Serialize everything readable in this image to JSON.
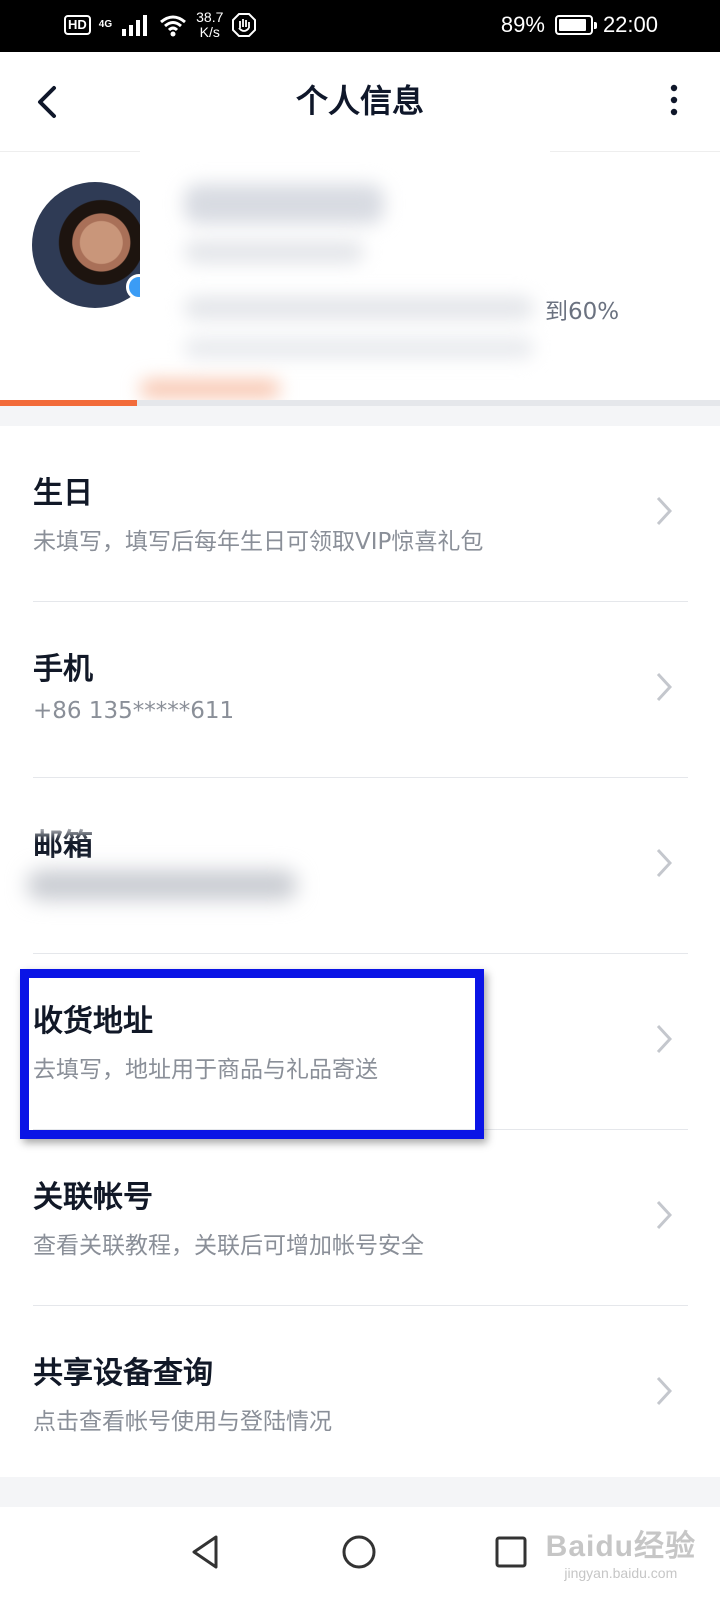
{
  "status_bar": {
    "hd": "HD",
    "network": "4G",
    "speed_value": "38.7",
    "speed_unit": "K/s",
    "battery_percent": "89%",
    "battery_level": 0.89,
    "time": "22:00"
  },
  "header": {
    "title": "个人信息",
    "back_icon": "chevron-left-icon",
    "more_icon": "more-vertical-icon"
  },
  "profile": {
    "completion_text": "到60%",
    "progress": 0.6,
    "accent_color": "#f26b3a"
  },
  "items": [
    {
      "title": "生日",
      "subtitle": "未填写，填写后每年生日可领取VIP惊喜礼包"
    },
    {
      "title": "手机",
      "subtitle": "+86 135*****611"
    },
    {
      "title": "邮箱",
      "subtitle": ""
    },
    {
      "title": "收货地址",
      "subtitle": "去填写，地址用于商品与礼品寄送"
    },
    {
      "title": "关联帐号",
      "subtitle": "查看关联教程，关联后可增加帐号安全"
    },
    {
      "title": "共享设备查询",
      "subtitle": "点击查看帐号使用与登陆情况"
    }
  ],
  "highlight_color": "#0a14e6",
  "watermark": {
    "main": "Baidu经验",
    "sub": "jingyan.baidu.com"
  }
}
